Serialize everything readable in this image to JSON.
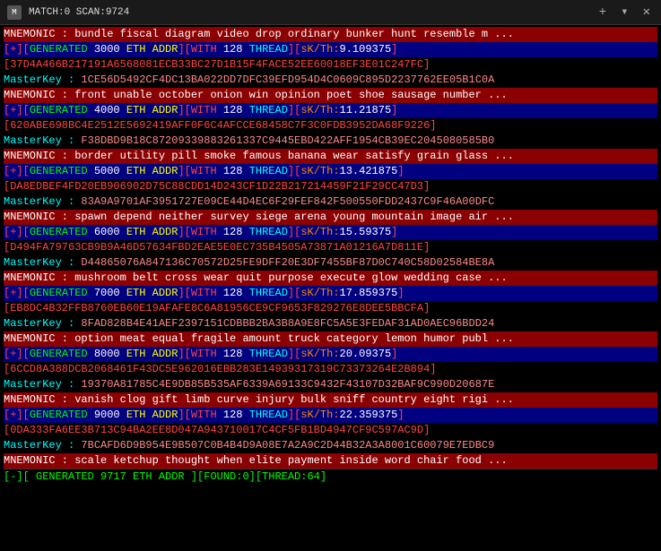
{
  "titlebar": {
    "icon": "M",
    "title": "MATCH:0 SCAN:9724",
    "close": "✕",
    "plus": "+",
    "caret": "▾"
  },
  "rows": [
    {
      "type": "mnemonic",
      "text": "MNEMONIC : bundle fiscal diagram video drop ordinary bunker hunt resemble m ..."
    },
    {
      "type": "generated",
      "prefix": "[+][GENERATED",
      "num": "3000",
      "mid": "ETH ADDR][WITH 128 THREAD][sK/Th:",
      "val": "9.109375",
      "end": "]"
    },
    {
      "type": "addr",
      "text": "37D4A466B217191A6568081ECB33BC27D1B15F4FACE52EE60018EF3E01C247FC"
    },
    {
      "type": "masterkey",
      "label": "MasterKey : ",
      "text": "1CE56D5492CF4DC13BA022DD7DFC39EFD954D4C0609C895D2237762EE05B1C0A"
    },
    {
      "type": "mnemonic",
      "text": "MNEMONIC : front unable october onion win opinion poet shoe sausage number ..."
    },
    {
      "type": "generated",
      "prefix": "[+][GENERATED",
      "num": "4000",
      "mid": "ETH ADDR][WITH 128 THREAD][sK/Th:",
      "val": "11.21875",
      "end": "]"
    },
    {
      "type": "addr",
      "text": "620ABE698BC4E2512E5692419AFF0F6C4AFCCE68458C7F3C0FDB3952DA68F9226"
    },
    {
      "type": "masterkey",
      "label": "MasterKey : ",
      "text": "F38DBD9B18C87209339883261337C9445EBD422AFF1954CB39EC2045080585B0"
    },
    {
      "type": "mnemonic",
      "text": "MNEMONIC : border utility pill smoke famous banana wear satisfy grain glass ..."
    },
    {
      "type": "generated",
      "prefix": "[+][GENERATED",
      "num": "5000",
      "mid": "ETH ADDR][WITH 128 THREAD][sK/Th:",
      "val": "13.421875",
      "end": "]"
    },
    {
      "type": "addr",
      "text": "DA8EDBEF4FD20EB906902D75C88CDD14D243CF1D22B217214459F21F29CC47D3"
    },
    {
      "type": "masterkey",
      "label": "MasterKey : ",
      "text": "83A9A9701AF3951727E09CE44D4EC6F29FEF842F500550FDD2437C9F46A00DFC"
    },
    {
      "type": "mnemonic",
      "text": "MNEMONIC : spawn depend neither survey siege arena young mountain image air ..."
    },
    {
      "type": "generated",
      "prefix": "[+][GENERATED",
      "num": "6000",
      "mid": "ETH ADDR][WITH 128 THREAD][sK/Th:",
      "val": "15.59375",
      "end": "]"
    },
    {
      "type": "addr",
      "text": "D494FA79763CB9B9A46D57634FBD2EAE5E0EC735B4505A73871A01216A7D811E"
    },
    {
      "type": "masterkey",
      "label": "MasterKey : ",
      "text": "D44865076A847136C70572D25FE9DFF20E3DF7455BF87D0C740C58D02584BE8A"
    },
    {
      "type": "mnemonic",
      "text": "MNEMONIC : mushroom belt cross wear quit purpose execute glow wedding case ..."
    },
    {
      "type": "generated",
      "prefix": "[+][GENERATED",
      "num": "7000",
      "mid": "ETH ADDR][WITH 128 THREAD][sK/Th:",
      "val": "17.859375",
      "end": "]"
    },
    {
      "type": "addr",
      "text": "EB8DC4B32FFB8760EB60E19AFAFE8C6A81956CE9CF9653F829276E8DEE5BBCFA"
    },
    {
      "type": "masterkey",
      "label": "MasterKey : ",
      "text": "8FAD828B4E41AEF2397151CDBBB2BA3B8A9E8FC5A5E3FEDAF31AD0AEC96BDD24"
    },
    {
      "type": "mnemonic",
      "text": "MNEMONIC : option meat equal fragile amount truck category lemon humor publ ..."
    },
    {
      "type": "generated",
      "prefix": "[+][GENERATED",
      "num": "8000",
      "mid": "ETH ADDR][WITH 128 THREAD][sK/Th:",
      "val": "20.09375",
      "end": "]"
    },
    {
      "type": "addr",
      "text": "6CCD8A388DCB2068461F43DC5E962016EBB283E14939317319C73373264E2B894"
    },
    {
      "type": "masterkey",
      "label": "MasterKey : ",
      "text": "19370A81785C4E9DB85B535AF6339A69133C9432F43107D32BAF9C990D20687E"
    },
    {
      "type": "mnemonic",
      "text": "MNEMONIC : vanish clog gift limb curve injury bulk sniff country eight rigi ..."
    },
    {
      "type": "generated",
      "prefix": "[+][GENERATED",
      "num": "9000",
      "mid": "ETH ADDR][WITH 128 THREAD][sK/Th:",
      "val": "22.359375",
      "end": "]"
    },
    {
      "type": "addr",
      "text": "0DA333FA6EE3B713C94BA2EE8D047A943710017C4CF5FB1BD4947CF9C597AC9D"
    },
    {
      "type": "masterkey",
      "label": "MasterKey : ",
      "text": "7BCAFD6D9B954E9B507C0B4B4D9A08E7A2A9C2D44B32A3A8001C60079E7EDBC9"
    },
    {
      "type": "mnemonic",
      "text": "MNEMONIC : scale ketchup thought when elite payment inside word chair food ..."
    },
    {
      "type": "statusbar",
      "text": "[-][ GENERATED  9717  ETH ADDR  ][FOUND:0][THREAD:64]"
    }
  ]
}
